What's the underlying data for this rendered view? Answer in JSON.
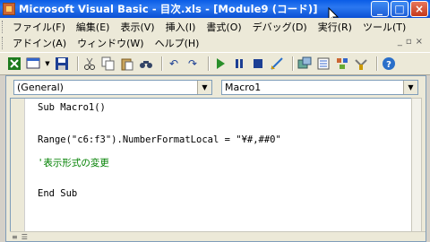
{
  "window": {
    "title": "Microsoft Visual Basic - 目次.xls - [Module9 (コード)]",
    "buttons": {
      "minimize": "_",
      "maximize": "□",
      "close": "×"
    }
  },
  "menu": {
    "row1": [
      "ファイル(F)",
      "編集(E)",
      "表示(V)",
      "挿入(I)",
      "書式(O)",
      "デバッグ(D)",
      "実行(R)",
      "ツール(T)"
    ],
    "row2": [
      "アドイン(A)",
      "ウィンドウ(W)",
      "ヘルプ(H)"
    ],
    "mdi_controls": [
      "_",
      "▫",
      "×"
    ]
  },
  "toolbar": {
    "icons": [
      "excel-view-icon",
      "insert-module-icon",
      "save-icon",
      "cut-icon",
      "copy-icon",
      "paste-icon",
      "find-icon",
      "undo-icon",
      "redo-icon",
      "run-icon",
      "break-icon",
      "reset-icon",
      "design-mode-icon",
      "project-explorer-icon",
      "properties-icon",
      "object-browser-icon",
      "toolbox-icon",
      "help-icon"
    ]
  },
  "code_window": {
    "object_combo": "(General)",
    "procedure_combo": "Macro1",
    "lines": [
      {
        "text": "Sub Macro1()",
        "kind": "code"
      },
      {
        "text": "Range(\"c6:f3\").NumberFormatLocal = \"¥#,##0\"",
        "kind": "code"
      },
      {
        "text": "'表示形式の変更",
        "kind": "comment"
      },
      {
        "text": "End Sub",
        "kind": "code"
      }
    ]
  },
  "colors": {
    "titlebar": "#0a5ce6",
    "comment": "#008000",
    "background": "#ece9d8"
  }
}
